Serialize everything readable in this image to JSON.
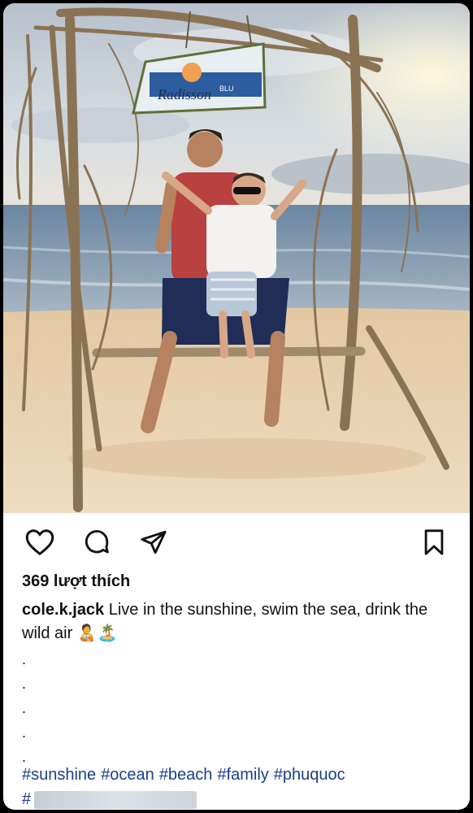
{
  "post": {
    "likes_text": "369 lượt thích",
    "username": "cole.k.jack",
    "caption": " Live in the sunshine, swim the sea, drink the wild air",
    "caption_emoji": "🧑‍🍼🏝️",
    "dots": [
      ".",
      ".",
      ".",
      ".",
      "."
    ],
    "hashtags": [
      "#sunshine",
      "#ocean",
      "#beach",
      "#family",
      "#phuquoc"
    ],
    "hashtag_partial": "#",
    "sign_text": "Radisson",
    "sign_subtext": "BLU"
  },
  "icons": {
    "like": "heart-icon",
    "comment": "comment-icon",
    "share": "send-icon",
    "save": "bookmark-icon"
  },
  "colors": {
    "sky": "#c9d3dc",
    "sea": "#6f8aa6",
    "sand": "#e6cfae",
    "hashtag": "#1a3d8f"
  }
}
